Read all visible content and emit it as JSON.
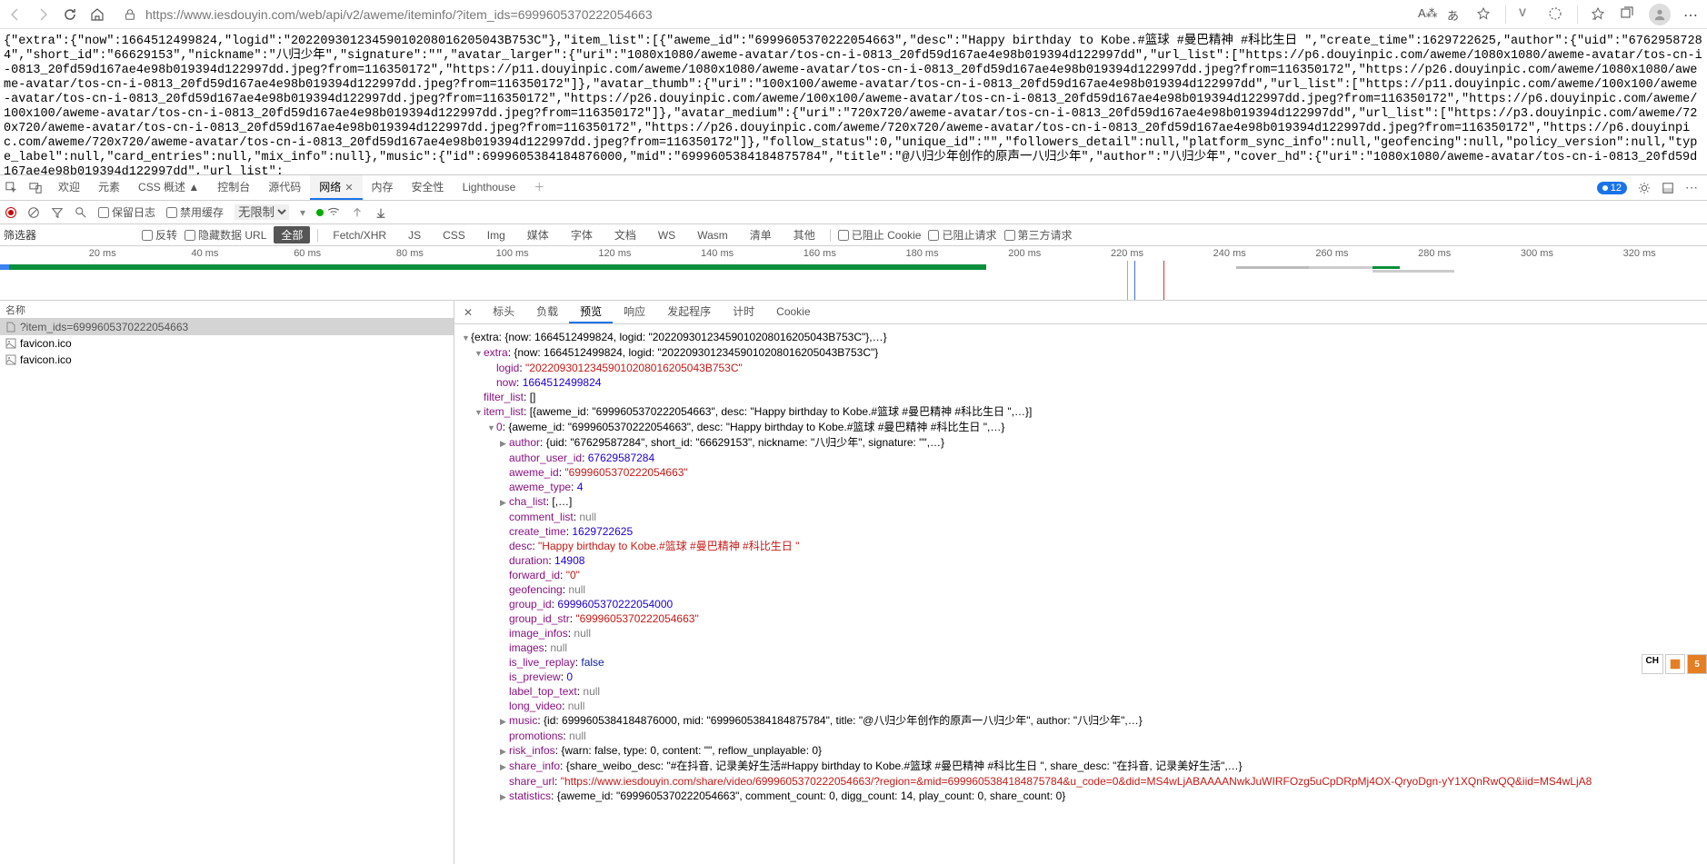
{
  "browser": {
    "url": "https://www.iesdouyin.com/web/api/v2/aweme/iteminfo/?item_ids=6999605370222054663",
    "translate_label": "あ",
    "read_aloud": "A⁂"
  },
  "raw_body": "{\"extra\":{\"now\":1664512499824,\"logid\":\"20220930123459010208016205043B753C\"},\"item_list\":[{\"aweme_id\":\"6999605370222054663\",\"desc\":\"Happy birthday to Kobe.#篮球 #曼巴精神 #科比生日 \",\"create_time\":1629722625,\"author\":{\"uid\":\"67629587284\",\"short_id\":\"66629153\",\"nickname\":\"八归少年\",\"signature\":\"\",\"avatar_larger\":{\"uri\":\"1080x1080/aweme-avatar/tos-cn-i-0813_20fd59d167ae4e98b019394d122997dd\",\"url_list\":[\"https://p6.douyinpic.com/aweme/1080x1080/aweme-avatar/tos-cn-i-0813_20fd59d167ae4e98b019394d122997dd.jpeg?from=116350172\",\"https://p11.douyinpic.com/aweme/1080x1080/aweme-avatar/tos-cn-i-0813_20fd59d167ae4e98b019394d122997dd.jpeg?from=116350172\",\"https://p26.douyinpic.com/aweme/1080x1080/aweme-avatar/tos-cn-i-0813_20fd59d167ae4e98b019394d122997dd.jpeg?from=116350172\"]},\"avatar_thumb\":{\"uri\":\"100x100/aweme-avatar/tos-cn-i-0813_20fd59d167ae4e98b019394d122997dd\",\"url_list\":[\"https://p11.douyinpic.com/aweme/100x100/aweme-avatar/tos-cn-i-0813_20fd59d167ae4e98b019394d122997dd.jpeg?from=116350172\",\"https://p26.douyinpic.com/aweme/100x100/aweme-avatar/tos-cn-i-0813_20fd59d167ae4e98b019394d122997dd.jpeg?from=116350172\",\"https://p6.douyinpic.com/aweme/100x100/aweme-avatar/tos-cn-i-0813_20fd59d167ae4e98b019394d122997dd.jpeg?from=116350172\"]},\"avatar_medium\":{\"uri\":\"720x720/aweme-avatar/tos-cn-i-0813_20fd59d167ae4e98b019394d122997dd\",\"url_list\":[\"https://p3.douyinpic.com/aweme/720x720/aweme-avatar/tos-cn-i-0813_20fd59d167ae4e98b019394d122997dd.jpeg?from=116350172\",\"https://p26.douyinpic.com/aweme/720x720/aweme-avatar/tos-cn-i-0813_20fd59d167ae4e98b019394d122997dd.jpeg?from=116350172\",\"https://p6.douyinpic.com/aweme/720x720/aweme-avatar/tos-cn-i-0813_20fd59d167ae4e98b019394d122997dd.jpeg?from=116350172\"]},\"follow_status\":0,\"unique_id\":\"\",\"followers_detail\":null,\"platform_sync_info\":null,\"geofencing\":null,\"policy_version\":null,\"type_label\":null,\"card_entries\":null,\"mix_info\":null},\"music\":{\"id\":6999605384184876000,\"mid\":\"6999605384184875784\",\"title\":\"@八归少年创作的原声一八归少年\",\"author\":\"八归少年\",\"cover_hd\":{\"uri\":\"1080x1080/aweme-avatar/tos-cn-i-0813_20fd59d167ae4e98b019394d122997dd\",\"url_list\":",
  "devtools": {
    "tabs": {
      "welcome": "欢迎",
      "elements": "元素",
      "css_overview": "CSS 概述 ▲",
      "console": "控制台",
      "sources": "源代码",
      "network": "网络",
      "memory": "内存",
      "security": "安全性",
      "lighthouse": "Lighthouse"
    },
    "issues_count": "12",
    "toolbar2": {
      "preserve_log": "保留日志",
      "disable_cache": "禁用缓存",
      "no_throttle": "无限制"
    },
    "filters": {
      "label": "筛选器",
      "invert": "反转",
      "hide_data": "隐藏数据 URL",
      "all": "全部",
      "fetch": "Fetch/XHR",
      "js": "JS",
      "css": "CSS",
      "img": "Img",
      "media": "媒体",
      "font": "字体",
      "doc": "文档",
      "ws": "WS",
      "wasm": "Wasm",
      "manifest": "清单",
      "other": "其他",
      "blocked_cookies": "已阻止 Cookie",
      "blocked_requests": "已阻止请求",
      "third_party": "第三方请求"
    },
    "timeline_ticks": [
      "20 ms",
      "40 ms",
      "60 ms",
      "80 ms",
      "100 ms",
      "120 ms",
      "140 ms",
      "160 ms",
      "180 ms",
      "200 ms",
      "220 ms",
      "240 ms",
      "260 ms",
      "280 ms",
      "300 ms",
      "320 ms"
    ],
    "req_header": "名称",
    "requests": [
      {
        "name": "?item_ids=6999605370222054663",
        "selected": true,
        "icon": "doc"
      },
      {
        "name": "favicon.ico",
        "selected": false,
        "icon": "img"
      },
      {
        "name": "favicon.ico",
        "selected": false,
        "icon": "img"
      }
    ],
    "detail_tabs": {
      "headers": "标头",
      "payload": "负载",
      "preview": "预览",
      "response": "响应",
      "initiator": "发起程序",
      "timing": "计时",
      "cookies": "Cookie"
    },
    "preview": {
      "root_summary": "{extra: {now: 1664512499824, logid: \"20220930123459010208016205043B753C\"},…}",
      "extra_summary": "{now: 1664512499824, logid: \"20220930123459010208016205043B753C\"}",
      "logid_val": "\"20220930123459010208016205043B753C\"",
      "now_val": "1664512499824",
      "filter_list_val": "[]",
      "item_list_summary": "[{aweme_id: \"6999605370222054663\", desc: \"Happy birthday to Kobe.#篮球 #曼巴精神 #科比生日 \",…}]",
      "item0_summary": "{aweme_id: \"6999605370222054663\", desc: \"Happy birthday to Kobe.#篮球 #曼巴精神 #科比生日 \",…}",
      "author_summary": "{uid: \"67629587284\", short_id: \"66629153\", nickname: \"八归少年\", signature: \"\",…}",
      "author_user_id": "67629587284",
      "aweme_id": "\"6999605370222054663\"",
      "aweme_type": "4",
      "cha_list_summary": "[,…]",
      "comment_list": "null",
      "create_time": "1629722625",
      "desc": "\"Happy birthday to Kobe.#篮球 #曼巴精神 #科比生日 \"",
      "duration": "14908",
      "forward_id": "\"0\"",
      "geofencing": "null",
      "group_id": "6999605370222054000",
      "group_id_str": "\"6999605370222054663\"",
      "image_infos": "null",
      "images": "null",
      "is_live_replay": "false",
      "is_preview": "0",
      "label_top_text": "null",
      "long_video": "null",
      "music_summary": "{id: 6999605384184876000, mid: \"6999605384184875784\", title: \"@八归少年创作的原声一八归少年\", author: \"八归少年\",…}",
      "promotions": "null",
      "risk_infos_summary": "{warn: false, type: 0, content: \"\", reflow_unplayable: 0}",
      "share_info_summary": "{share_weibo_desc: \"#在抖音, 记录美好生活#Happy birthday to Kobe.#篮球 #曼巴精神 #科比生日 \", share_desc: \"在抖音, 记录美好生活\",…}",
      "share_url": "\"https://www.iesdouyin.com/share/video/6999605370222054663/?region=&mid=6999605384184875784&u_code=0&did=MS4wLjABAAAANwkJuWIRFOzg5uCpDRpMj4OX-QryoDgn-yY1XQnRwQQ&iid=MS4wLjA8",
      "statistics_summary": "{aweme_id: \"6999605370222054663\", comment_count: 0, digg_count: 14, play_count: 0, share_count: 0}"
    }
  },
  "side": {
    "ch": "CH"
  }
}
